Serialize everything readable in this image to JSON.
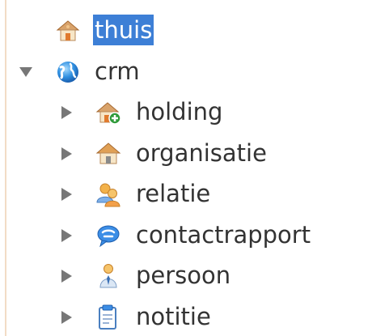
{
  "tree": {
    "root": {
      "label": "thuis",
      "icon": "home-icon",
      "selected": true
    },
    "crm": {
      "label": "crm",
      "icon": "globe-icon",
      "expanded": true,
      "children": [
        {
          "label": "holding",
          "icon": "holding-house-icon"
        },
        {
          "label": "organisatie",
          "icon": "organisation-house-icon"
        },
        {
          "label": "relatie",
          "icon": "relations-people-icon"
        },
        {
          "label": "contactrapport",
          "icon": "contact-report-icon"
        },
        {
          "label": "persoon",
          "icon": "person-icon"
        },
        {
          "label": "notitie",
          "icon": "note-icon"
        }
      ]
    }
  },
  "colors": {
    "selection": "#3d7fd6",
    "text": "#333333",
    "arrow": "#777777",
    "border": "#f2dcc6"
  }
}
